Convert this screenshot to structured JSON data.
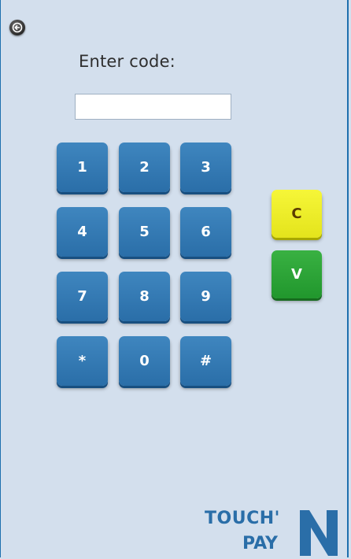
{
  "header": {
    "back_icon": "back-arrow-icon",
    "title": "Enter code:"
  },
  "code_input": {
    "value": "",
    "placeholder": ""
  },
  "keypad": {
    "keys": [
      "1",
      "2",
      "3",
      "4",
      "5",
      "6",
      "7",
      "8",
      "9",
      "*",
      "0",
      "#"
    ]
  },
  "actions": {
    "clear_label": "C",
    "validate_label": "V"
  },
  "brand": {
    "line1": "TOUCH'",
    "line2": "PAY",
    "mark": "N",
    "color": "#2a6ea8"
  },
  "colors": {
    "background": "#d3dfed",
    "key_blue": "#2f78b4",
    "clear_yellow": "#f0f02a",
    "validate_green": "#2da337"
  }
}
